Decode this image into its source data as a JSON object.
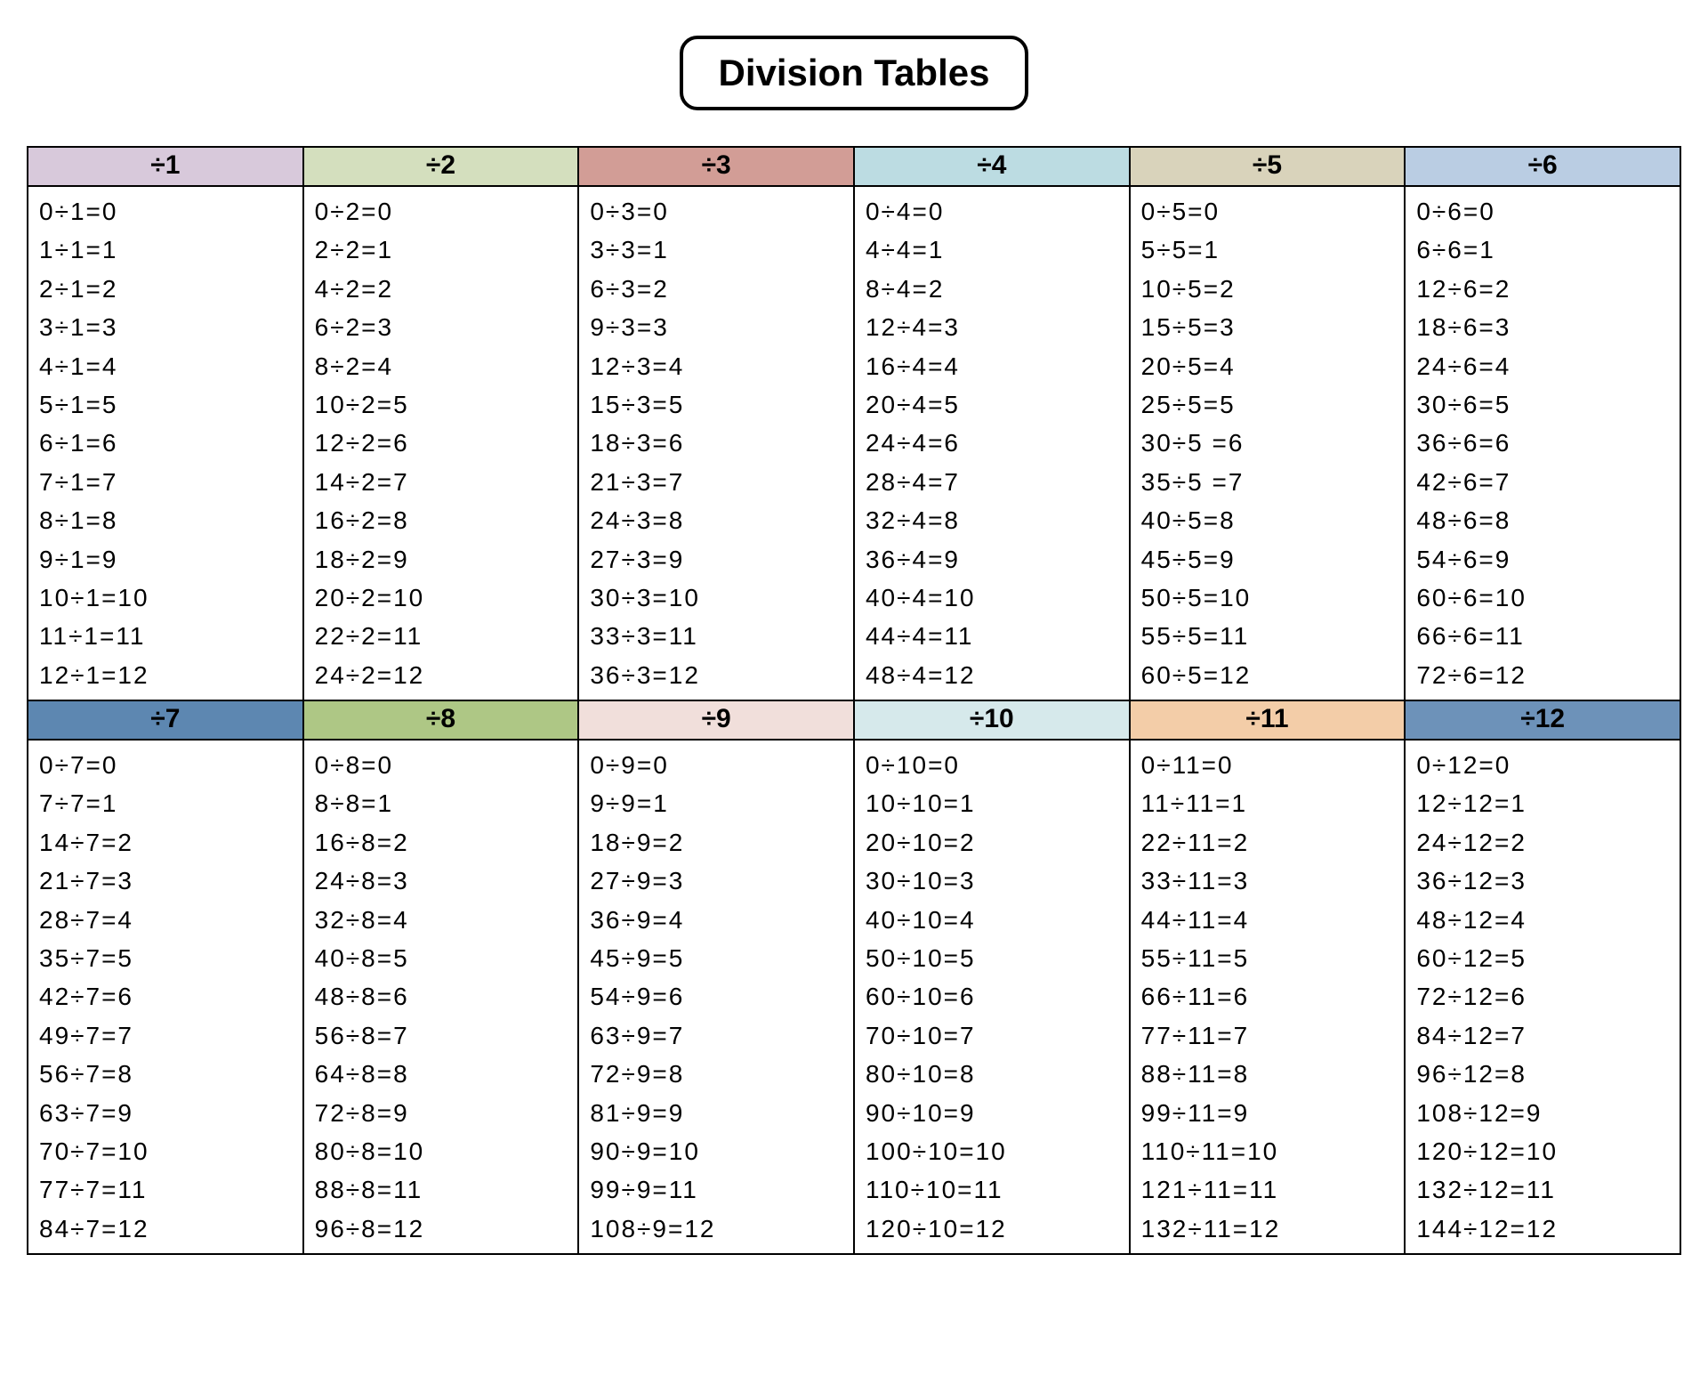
{
  "title": "Division Tables",
  "colors": {
    "1": "#d8c9db",
    "2": "#d4dfbe",
    "3": "#d29d96",
    "4": "#bcdce2",
    "5": "#d9d3bb",
    "6": "#bacde3",
    "7": "#5d87b1",
    "8": "#aec785",
    "9": "#f1dfdb",
    "10": "#d6e9eb",
    "11": "#f3cda8",
    "12": "#6d92b9"
  },
  "tables": [
    {
      "divisor": 1,
      "header": "÷1",
      "rows": [
        "0÷1=0",
        "1÷1=1",
        "2÷1=2",
        "3÷1=3",
        "4÷1=4",
        "5÷1=5",
        "6÷1=6",
        "7÷1=7",
        "8÷1=8",
        "9÷1=9",
        "10÷1=10",
        "11÷1=11",
        "12÷1=12"
      ]
    },
    {
      "divisor": 2,
      "header": "÷2",
      "rows": [
        "0÷2=0",
        "2÷2=1",
        "4÷2=2",
        "6÷2=3",
        "8÷2=4",
        "10÷2=5",
        "12÷2=6",
        "14÷2=7",
        "16÷2=8",
        "18÷2=9",
        "20÷2=10",
        "22÷2=11",
        "24÷2=12"
      ]
    },
    {
      "divisor": 3,
      "header": "÷3",
      "rows": [
        "0÷3=0",
        "3÷3=1",
        "6÷3=2",
        "9÷3=3",
        "12÷3=4",
        "15÷3=5",
        "18÷3=6",
        "21÷3=7",
        "24÷3=8",
        "27÷3=9",
        "30÷3=10",
        "33÷3=11",
        "36÷3=12"
      ]
    },
    {
      "divisor": 4,
      "header": "÷4",
      "rows": [
        "0÷4=0",
        "4÷4=1",
        "8÷4=2",
        "12÷4=3",
        "16÷4=4",
        "20÷4=5",
        "24÷4=6",
        "28÷4=7",
        "32÷4=8",
        "36÷4=9",
        "40÷4=10",
        "44÷4=11",
        "48÷4=12"
      ]
    },
    {
      "divisor": 5,
      "header": "÷5",
      "rows": [
        "0÷5=0",
        "5÷5=1",
        "10÷5=2",
        "15÷5=3",
        "20÷5=4",
        "25÷5=5",
        "30÷5 =6",
        "35÷5 =7",
        "40÷5=8",
        "45÷5=9",
        "50÷5=10",
        "55÷5=11",
        "60÷5=12"
      ]
    },
    {
      "divisor": 6,
      "header": "÷6",
      "rows": [
        "0÷6=0",
        "6÷6=1",
        "12÷6=2",
        "18÷6=3",
        "24÷6=4",
        "30÷6=5",
        "36÷6=6",
        "42÷6=7",
        "48÷6=8",
        "54÷6=9",
        "60÷6=10",
        "66÷6=11",
        "72÷6=12"
      ]
    },
    {
      "divisor": 7,
      "header": "÷7",
      "rows": [
        "0÷7=0",
        "7÷7=1",
        "14÷7=2",
        "21÷7=3",
        "28÷7=4",
        "35÷7=5",
        "42÷7=6",
        "49÷7=7",
        "56÷7=8",
        "63÷7=9",
        "70÷7=10",
        "77÷7=11",
        "84÷7=12"
      ]
    },
    {
      "divisor": 8,
      "header": "÷8",
      "rows": [
        "0÷8=0",
        "8÷8=1",
        "16÷8=2",
        "24÷8=3",
        "32÷8=4",
        "40÷8=5",
        "48÷8=6",
        "56÷8=7",
        "64÷8=8",
        "72÷8=9",
        "80÷8=10",
        "88÷8=11",
        "96÷8=12"
      ]
    },
    {
      "divisor": 9,
      "header": "÷9",
      "rows": [
        "0÷9=0",
        "9÷9=1",
        "18÷9=2",
        "27÷9=3",
        "36÷9=4",
        "45÷9=5",
        "54÷9=6",
        "63÷9=7",
        "72÷9=8",
        "81÷9=9",
        "90÷9=10",
        "99÷9=11",
        "108÷9=12"
      ]
    },
    {
      "divisor": 10,
      "header": "÷10",
      "rows": [
        "0÷10=0",
        "10÷10=1",
        "20÷10=2",
        "30÷10=3",
        "40÷10=4",
        "50÷10=5",
        "60÷10=6",
        "70÷10=7",
        "80÷10=8",
        "90÷10=9",
        "100÷10=10",
        "110÷10=11",
        "120÷10=12"
      ]
    },
    {
      "divisor": 11,
      "header": "÷11",
      "rows": [
        "0÷11=0",
        "11÷11=1",
        "22÷11=2",
        "33÷11=3",
        "44÷11=4",
        "55÷11=5",
        "66÷11=6",
        "77÷11=7",
        "88÷11=8",
        "99÷11=9",
        "110÷11=10",
        "121÷11=11",
        "132÷11=12"
      ]
    },
    {
      "divisor": 12,
      "header": "÷12",
      "rows": [
        "0÷12=0",
        "12÷12=1",
        "24÷12=2",
        "36÷12=3",
        "48÷12=4",
        "60÷12=5",
        "72÷12=6",
        "84÷12=7",
        "96÷12=8",
        "108÷12=9",
        "120÷12=10",
        "132÷12=11",
        "144÷12=12"
      ]
    }
  ]
}
